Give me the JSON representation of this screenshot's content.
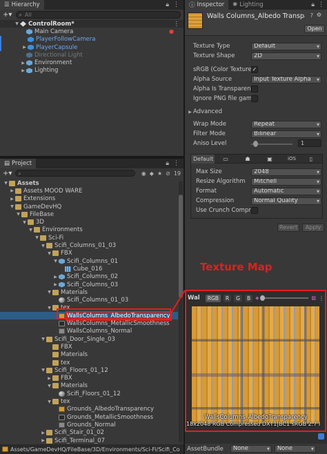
{
  "hierarchy": {
    "tab_label": "Hierarchy",
    "add_label": "+▾",
    "search_placeholder": "All",
    "scene_name": "ControlRoom*",
    "items": [
      {
        "label": "Main Camera"
      },
      {
        "label": "PlayerFollowCamera"
      },
      {
        "label": "PlayerCapsule"
      },
      {
        "label": "Directional Light"
      },
      {
        "label": "Environment"
      },
      {
        "label": "Lighting"
      }
    ]
  },
  "inspector": {
    "tab_label": "Inspector",
    "lighting_tab_label": "Lighting",
    "asset_title": "Walls Columns_Albedo Transpar",
    "open_label": "Open",
    "texture_type_label": "Texture Type",
    "texture_type_value": "Default",
    "texture_shape_label": "Texture Shape",
    "texture_shape_value": "2D",
    "srgb_label": "sRGB (Color Texture)",
    "srgb_check": "✓",
    "alpha_source_label": "Alpha Source",
    "alpha_source_value": "Input Texture Alpha",
    "alpha_transparency_label": "Alpha Is Transparenc",
    "ignore_png_label": "Ignore PNG file gamm",
    "advanced_label": "Advanced",
    "wrap_mode_label": "Wrap Mode",
    "wrap_mode_value": "Repeat",
    "filter_mode_label": "Filter Mode",
    "filter_mode_value": "Bilinear",
    "aniso_label": "Aniso Level",
    "aniso_value": "1",
    "platform_default_label": "Default",
    "platform_ios_label": "iOS",
    "max_size_label": "Max Size",
    "max_size_value": "2048",
    "resize_label": "Resize Algorithm",
    "resize_value": "Mitchell",
    "format_label": "Format",
    "format_value": "Automatic",
    "compression_label": "Compression",
    "compression_value": "Normal Quality",
    "crunch_label": "Use Crunch Compres",
    "revert_label": "Revert",
    "apply_label": "Apply"
  },
  "preview": {
    "name_label": "Wal",
    "channel_rgb": "RGB",
    "channel_r": "R",
    "channel_g": "G",
    "channel_b": "B",
    "caption_name": "WallsColumns_AlbedoTransparency",
    "caption_info": "18x2048  RGB Compressed DXT1|BC1 sRGB  2.7 I",
    "asset_bundle_label": "AssetBundle",
    "asset_bundle_value": "None",
    "asset_bundle_variant_value": "None"
  },
  "annotation": {
    "label": "Texture Map",
    "color": "#e0201c"
  },
  "project": {
    "tab_label": "Project",
    "add_label": "+▾",
    "hidden_count": "19",
    "breadcrumb": "Assets/GameDevHQ/FileBase/3D/Environments/Sci-Fi/Scifi_Co",
    "tree": [
      {
        "label": "Assets",
        "indent": 0,
        "arrow": "▼",
        "icon": "folder",
        "bold": true
      },
      {
        "label": "Assets MOOD WARE",
        "indent": 1,
        "arrow": "▶",
        "icon": "folder"
      },
      {
        "label": "Extensions",
        "indent": 1,
        "arrow": "▶",
        "icon": "folder"
      },
      {
        "label": "GameDevHQ",
        "indent": 1,
        "arrow": "▼",
        "icon": "folder"
      },
      {
        "label": "FileBase",
        "indent": 2,
        "arrow": "▼",
        "icon": "folder"
      },
      {
        "label": "3D",
        "indent": 3,
        "arrow": "▼",
        "icon": "folder"
      },
      {
        "label": "Environments",
        "indent": 4,
        "arrow": "▼",
        "icon": "folder"
      },
      {
        "label": "Sci-Fi",
        "indent": 5,
        "arrow": "▼",
        "icon": "folder"
      },
      {
        "label": "Scifi_Columns_01_03",
        "indent": 6,
        "arrow": "▼",
        "icon": "folder"
      },
      {
        "label": "FBX",
        "indent": 7,
        "arrow": "▼",
        "icon": "folder"
      },
      {
        "label": "Scifi_Columns_01",
        "indent": 8,
        "arrow": "▼",
        "icon": "cube"
      },
      {
        "label": "Cube_016",
        "indent": 9,
        "arrow": "",
        "icon": "mesh"
      },
      {
        "label": "Scifi_Columns_02",
        "indent": 8,
        "arrow": "▶",
        "icon": "cube"
      },
      {
        "label": "Scifi_Columns_03",
        "indent": 8,
        "arrow": "▶",
        "icon": "cube"
      },
      {
        "label": "Materials",
        "indent": 7,
        "arrow": "▼",
        "icon": "folder"
      },
      {
        "label": "Scifi_Columns_01_03",
        "indent": 8,
        "arrow": "",
        "icon": "mat"
      },
      {
        "label": "tex",
        "indent": 7,
        "arrow": "▼",
        "icon": "folder"
      },
      {
        "label": "WallsColumns_AlbedoTransparency",
        "indent": 8,
        "arrow": "",
        "icon": "tex-ico",
        "selected": true
      },
      {
        "label": "WallsColumns_MetallicSmoothness",
        "indent": 8,
        "arrow": "",
        "icon": "tex-dark"
      },
      {
        "label": "WallsColumns_Normal",
        "indent": 8,
        "arrow": "",
        "icon": "tex-grey"
      },
      {
        "label": "Scifi_Door_Single_03",
        "indent": 6,
        "arrow": "▼",
        "icon": "folder"
      },
      {
        "label": "FBX",
        "indent": 7,
        "arrow": "",
        "icon": "folder"
      },
      {
        "label": "Materials",
        "indent": 7,
        "arrow": "",
        "icon": "folder"
      },
      {
        "label": "tex",
        "indent": 7,
        "arrow": "",
        "icon": "folder"
      },
      {
        "label": "Scifi_Floors_01_12",
        "indent": 6,
        "arrow": "▼",
        "icon": "folder"
      },
      {
        "label": "FBX",
        "indent": 7,
        "arrow": "▶",
        "icon": "folder"
      },
      {
        "label": "Materials",
        "indent": 7,
        "arrow": "▼",
        "icon": "folder"
      },
      {
        "label": "Scifi_Floors_01_12",
        "indent": 8,
        "arrow": "",
        "icon": "mat"
      },
      {
        "label": "tex",
        "indent": 7,
        "arrow": "▼",
        "icon": "folder"
      },
      {
        "label": "Grounds_AlbedoTransparency",
        "indent": 8,
        "arrow": "",
        "icon": "tex-ico"
      },
      {
        "label": "Grounds_MetallicSmoothness",
        "indent": 8,
        "arrow": "",
        "icon": "tex-dark"
      },
      {
        "label": "Grounds_Normal",
        "indent": 8,
        "arrow": "",
        "icon": "tex-grey"
      },
      {
        "label": "Scifi_Stair_01_02",
        "indent": 6,
        "arrow": "▶",
        "icon": "folder"
      },
      {
        "label": "Scifi_Terminal_07",
        "indent": 6,
        "arrow": "▶",
        "icon": "folder"
      }
    ]
  }
}
